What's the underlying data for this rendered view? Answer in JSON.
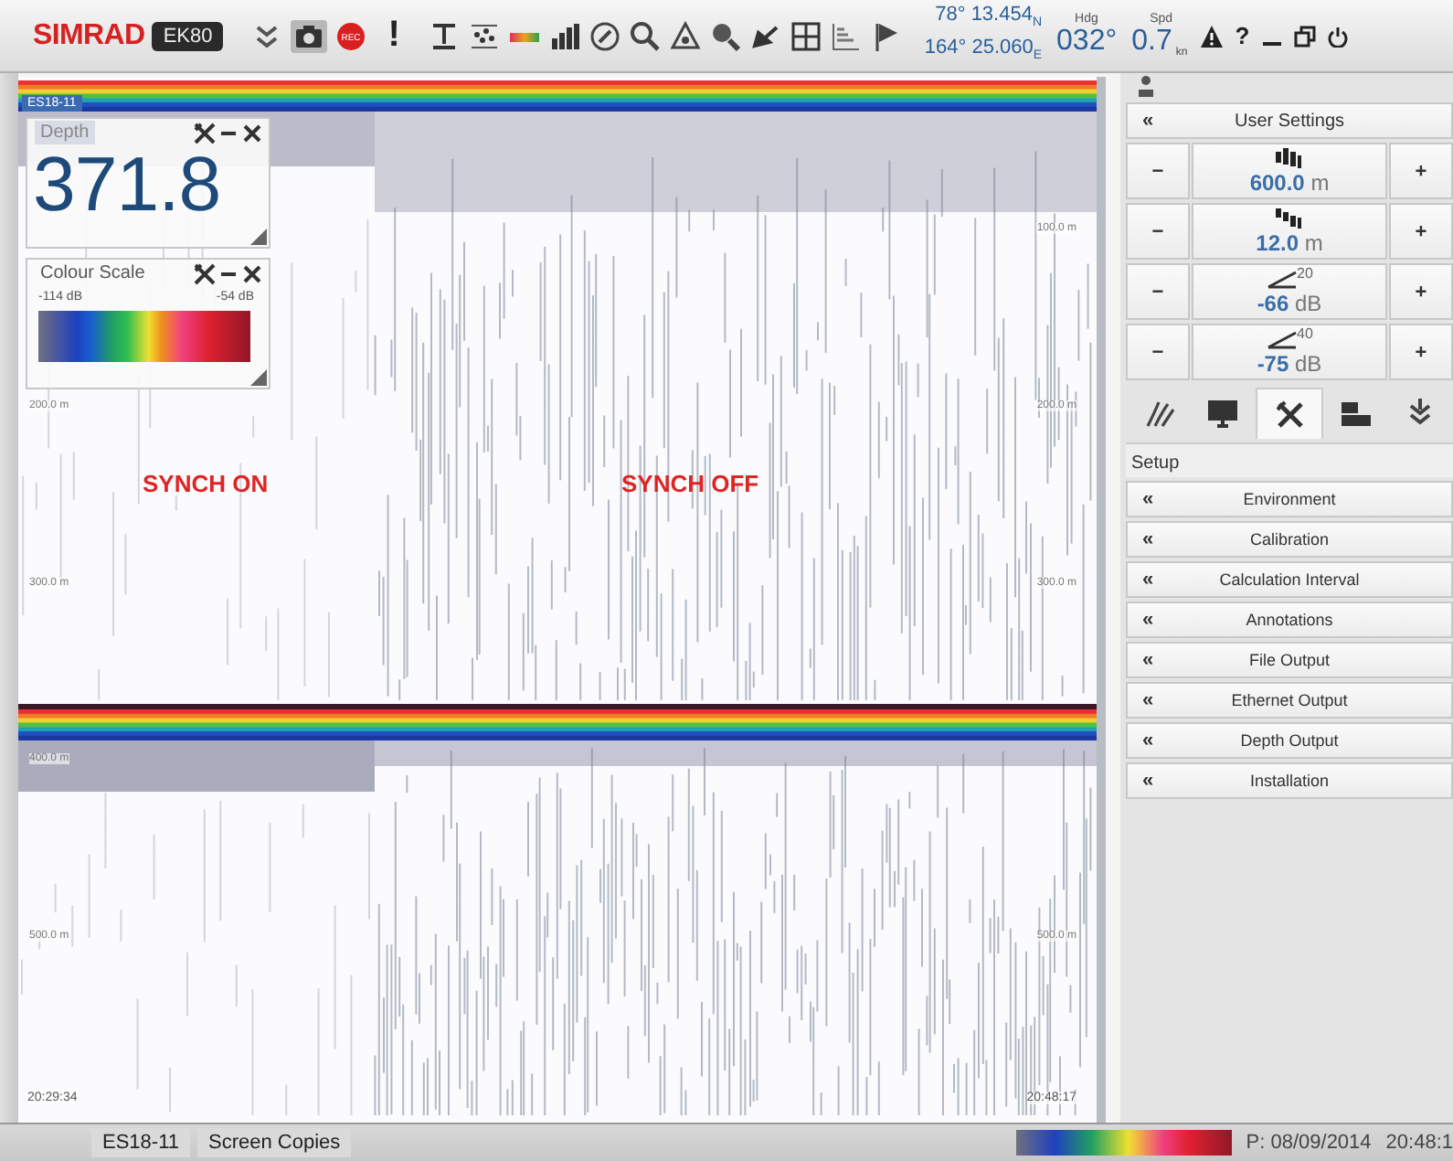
{
  "toolbar": {
    "logo": "SIMRAD",
    "product": "EK80",
    "record_label": "REC",
    "alert": "!",
    "latitude": "78° 13.454$_{N}$",
    "longitude": "164° 25.060$_{E}$",
    "heading": {
      "label": "Hdg",
      "value": "032°"
    },
    "speed": {
      "label": "Spd",
      "value": "0.7",
      "unit": "kn"
    },
    "help": "?"
  },
  "echogram": {
    "channel": "ES18-11",
    "panels": [
      {
        "depth_labels": [
          {
            "right": "100.0 m"
          },
          {
            "left": "200.0 m",
            "right": "200.0 m"
          },
          {
            "left": "300.0 m",
            "right": "300.0 m"
          }
        ]
      },
      {
        "depth_labels": [
          {
            "left": "400.0 m"
          },
          {
            "left": "500.0 m",
            "right": "500.0 m"
          }
        ]
      }
    ],
    "start_time": "20:29:34",
    "end_time": "20:48:17",
    "annotations": [
      {
        "text": "SYNCH ON"
      },
      {
        "text": "SYNCH OFF"
      }
    ]
  },
  "depth_window": {
    "title": "Depth",
    "value": "371.8"
  },
  "colour_scale_window": {
    "title": "Colour Scale",
    "min": "-114 dB",
    "max": "-54 dB"
  },
  "side_panel": {
    "header": {
      "arrow": "«",
      "label": "User Settings"
    },
    "settings": [
      {
        "kind": "range",
        "minus": "−",
        "value": "600.0",
        "unit": "m",
        "plus": "+"
      },
      {
        "kind": "start",
        "minus": "−",
        "value": "12.0",
        "unit": "m",
        "plus": "+"
      },
      {
        "kind": "tvg",
        "tvg": "20",
        "minus": "−",
        "value": "-66",
        "unit": "dB",
        "plus": "+"
      },
      {
        "kind": "tvg",
        "tvg": "40",
        "minus": "−",
        "value": "-75",
        "unit": "dB",
        "plus": "+"
      }
    ],
    "tabs": [
      {
        "kind": "sonar",
        "selected": false
      },
      {
        "kind": "display",
        "selected": false
      },
      {
        "kind": "setup",
        "selected": true
      },
      {
        "kind": "layout",
        "selected": false
      },
      {
        "kind": "more",
        "selected": false
      }
    ],
    "section": "Setup",
    "menu": [
      {
        "arrow": "«",
        "label": "Environment"
      },
      {
        "arrow": "«",
        "label": "Calibration"
      },
      {
        "arrow": "«",
        "label": "Calculation Interval"
      },
      {
        "arrow": "«",
        "label": "Annotations"
      },
      {
        "arrow": "«",
        "label": "File Output"
      },
      {
        "arrow": "«",
        "label": "Ethernet Output"
      },
      {
        "arrow": "«",
        "label": "Depth Output"
      },
      {
        "arrow": "«",
        "label": "Installation"
      }
    ]
  },
  "status_bar": {
    "tabs": [
      "ES18-11",
      "Screen Copies"
    ],
    "date": "P: 08/09/2014",
    "time": "20:48:1"
  }
}
